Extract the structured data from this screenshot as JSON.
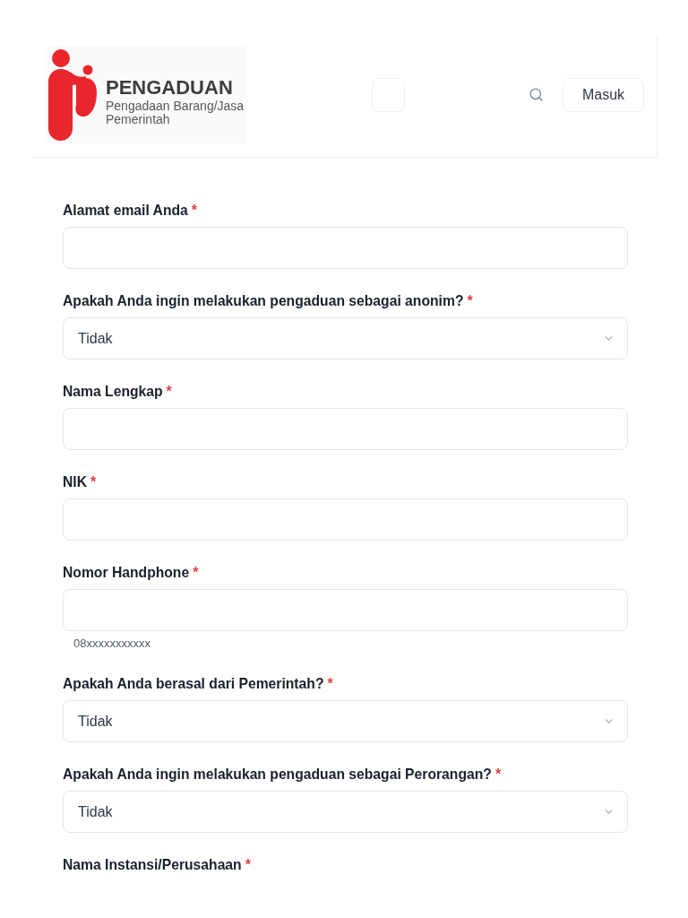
{
  "header": {
    "logo": {
      "title": "PENGADUAN",
      "subtitle_lines": [
        "Pengadaan Barang/Jasa",
        "Pemerintah"
      ]
    },
    "login_button": "Masuk"
  },
  "form": {
    "required_marker": "*",
    "fields": [
      {
        "kind": "text",
        "label": "Alamat email Anda",
        "required": true
      },
      {
        "kind": "select",
        "label": "Apakah Anda ingin melakukan pengaduan sebagai anonim?",
        "required": true,
        "value": "Tidak"
      },
      {
        "kind": "text",
        "label": "Nama Lengkap",
        "required": true
      },
      {
        "kind": "text",
        "label": "NIK",
        "required": true
      },
      {
        "kind": "text",
        "label": "Nomor Handphone",
        "required": true,
        "helper": "08xxxxxxxxxxx"
      },
      {
        "kind": "select",
        "label": "Apakah Anda berasal dari Pemerintah?",
        "required": true,
        "value": "Tidak"
      },
      {
        "kind": "select",
        "label": "Apakah Anda ingin melakukan pengaduan sebagai Perorangan?",
        "required": true,
        "value": "Tidak"
      },
      {
        "kind": "label",
        "label": "Nama Instansi/Perusahaan",
        "required": true
      }
    ]
  }
}
